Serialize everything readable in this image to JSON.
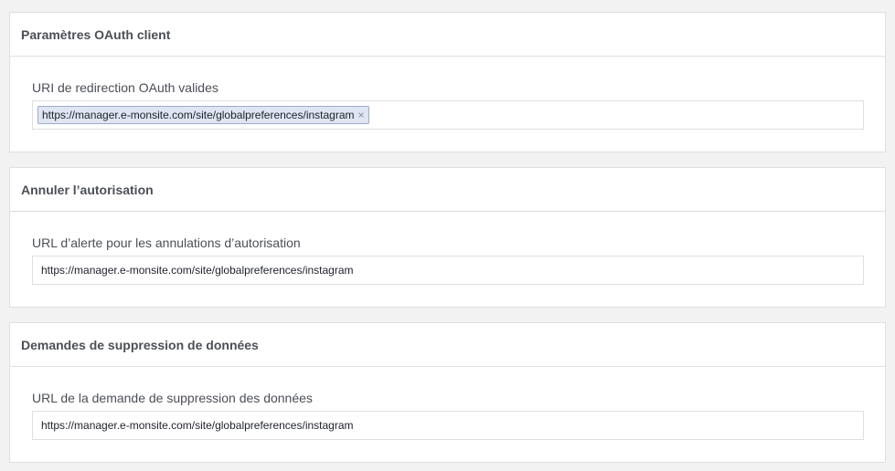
{
  "oauth_client": {
    "title": "Paramètres OAuth client",
    "field_label": "URI de redirection OAuth valides",
    "tokens": [
      {
        "value": "https://manager.e-monsite.com/site/globalpreferences/instagram",
        "remove_icon": "×"
      }
    ]
  },
  "deauthorize": {
    "title": "Annuler l’autorisation",
    "field_label": "URL d’alerte pour les annulations d’autorisation",
    "field_value": "https://manager.e-monsite.com/site/globalpreferences/instagram"
  },
  "data_deletion": {
    "title": "Demandes de suppression de données",
    "field_label": "URL de la demande de suppression des données",
    "field_value": "https://manager.e-monsite.com/site/globalpreferences/instagram"
  },
  "colors": {
    "background": "#f2f2f2",
    "panel_border": "#dddfe2",
    "token_background": "#dfe5f2",
    "token_border": "#9daccb"
  }
}
